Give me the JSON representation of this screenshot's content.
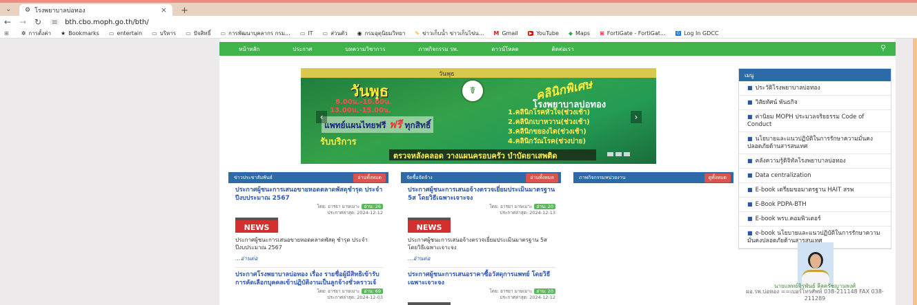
{
  "browser": {
    "tab_title": "โรงพยาบาลบ่อทอง",
    "close_symbol": "×",
    "new_tab_symbol": "+",
    "url": "bth.cbo.moph.go.th/bth/",
    "nav_icons": [
      "back-icon",
      "forward-icon",
      "reload-icon"
    ]
  },
  "bookmarks": [
    {
      "icon": "gear-icon",
      "label": "การตั้งค่า"
    },
    {
      "icon": "star-icon",
      "label": "Bookmarks"
    },
    {
      "icon": "folder-icon",
      "label": "entertain"
    },
    {
      "icon": "folder-icon",
      "label": "บริหาร"
    },
    {
      "icon": "folder-icon",
      "label": "ปัจสิทธิ์"
    },
    {
      "icon": "folder-icon",
      "label": "การพัฒนาบุคลากร กรม..."
    },
    {
      "icon": "folder-icon",
      "label": "IT"
    },
    {
      "icon": "folder-icon",
      "label": "ส่วนตัว"
    },
    {
      "icon": "globe-icon",
      "label": "กรมอุตุนิยมวิทยา"
    },
    {
      "icon": "pen-icon",
      "label": "ข่าวเก็บน้ำ ข่าวเก็บไข่น..."
    },
    {
      "icon": "gmail-icon",
      "label": "Gmail"
    },
    {
      "icon": "youtube-icon",
      "label": "YouTube"
    },
    {
      "icon": "maps-icon",
      "label": "Maps"
    },
    {
      "icon": "fortigate-icon",
      "label": "FortiGate - FortiGat..."
    },
    {
      "icon": "gdcc-icon",
      "label": "Log In GDCC"
    }
  ],
  "menu": [
    "หน้าหลัก",
    "ประกาศ",
    "บทความวิชาการ",
    "ภาพกิจกรรม รพ.",
    "ดาวน์โหลด",
    "ติดต่อเรา"
  ],
  "carousel": {
    "day_small": "วันพุธ",
    "day": "วันพุธ",
    "time1": "8.00น.-10.00น.",
    "time2": "13.00น.-15.00น.",
    "special": "คลินิกพิเศษ",
    "hospital": "โรงพยาบาลบ่อทอง",
    "clinics": [
      "1.คลินิกโรคหัวใจ(ช่วงเช้า)",
      "2.คลินิกเบาหวาน(ช่วงเช้า)",
      "3.คลินิกขยองไต(ช่วงเช้า)",
      "4.คลินิกวัณโรค(ช่วงบ่าย)"
    ],
    "free_prefix": "แพทย์แผนไทยฟรี",
    "free_label": "ฟรี",
    "free_suffix": "ทุกสิทธิ์",
    "accept": "รับบริการ",
    "banner": "ตรวจหลังคลอด วางแผนครอบครัว บำบัดยาเสพติด"
  },
  "columns": [
    {
      "title": "ข่าวประชาสัมพันธ์",
      "button": "อ่านทั้งหมด",
      "posts": [
        {
          "title": "ประกาศผู้ชนะการเสนอขายหอดตลาดพัสดุชำรุด ประจำปีงบประมาณ 2567",
          "author": "โดย: อารยา มาษเมาะ",
          "reads": "อ่าน: 26",
          "date": "ประกาศล่าสุด: 2024-12-12",
          "excerpt": "ประกาศผู้ชนะการเสนอขายหอดตลาดพัสดุ ชำรุด ประจำปีงบประมาณ 2567",
          "more": "...อ่านต่อ"
        },
        {
          "title": "ประกาศโรงพยาบาลบ่อทอง เรื่อง รายชื่อผู้มีสิทธิเข้ารับการคัดเลือกบุคคลเข้าปฏิบัติงานเป็นลูกจ้างชั่วคราวเจ้",
          "author": "โดย: อารยา มาษเมาะ",
          "reads": "อ่าน: 69",
          "date": "ประกาศล่าสุด: 2024-12-03"
        }
      ]
    },
    {
      "title": "จัดซื้อจัดจ้าง",
      "button": "อ่านทั้งหมด",
      "posts": [
        {
          "title": "ประกาศผู้ชนะการเสนอจ้างตรวจเยี่ยมประเมินมาตรฐาน 5ส โดยวิธีเฉพาะเจาะจง",
          "author": "โดย: อารยา มาษเมาะ",
          "reads": "อ่าน: 20",
          "date": "ประกาศล่าสุด: 2024-12-13",
          "excerpt": "ประกาศผู้ชนะการเสนอจ้างตรวจเยี่ยมประเมินมาตรฐาน 5ส โดยวิธีเฉพาะเจาะจง",
          "more": "...อ่านต่อ"
        },
        {
          "title": "ประกาศผู้ชนะการเสนอราคาซื้อวัสดุการแพทย์ โดยวิธีเฉพาะเจาะจง",
          "author": "โดย: อารยา มาษเมาะ",
          "reads": "อ่าน: 20",
          "date": "ประกาศล่าสุด: 2024-12-12"
        }
      ]
    },
    {
      "title": "ภาพกิจกรรมหน่วยงาน",
      "button": "ดูทั้งหมด"
    }
  ],
  "news_badge": "NEWS",
  "sidebar": {
    "title": "เมนู",
    "items": [
      "ประวัติโรงพยาบาลบ่อทอง",
      "วิสัยทัศน์ พันธกิจ",
      "ค่านิยม MOPH ประมวลจริยธรรม Code of Conduct",
      "นโยบายและแนวปฏิบัติในการรักษาความมั่นคงปลอดภัยด้านสารสนเทศ",
      "คลังความรู้ดิจิทัลโรงพยาบาลบ่อทอง",
      "Data centralization",
      "E-book เตรียมขอมาตรฐาน HAIT สรพ",
      "E-Book PDPA-BTH",
      "E-book พรบ.คอมพิวเตอร์",
      "e-book นโยบายและแนวปฏิบัติในการรักษาความมั่นคงปลอดภัยด้านสารสนเทศ"
    ],
    "officer_name": "นายแพทย์จิรพันธ์ ลีลครัชญานพงศ์",
    "officer_contact": "ผอ.รพ.บ่อทอง ==เบอร์โทรศัพท์ 038-211148 FAX 038-211289"
  },
  "colors": {
    "menu_green": "#3fb44a",
    "header_blue": "#2d6aa8",
    "button_red": "#d9534f",
    "link_blue": "#2e56b4"
  }
}
